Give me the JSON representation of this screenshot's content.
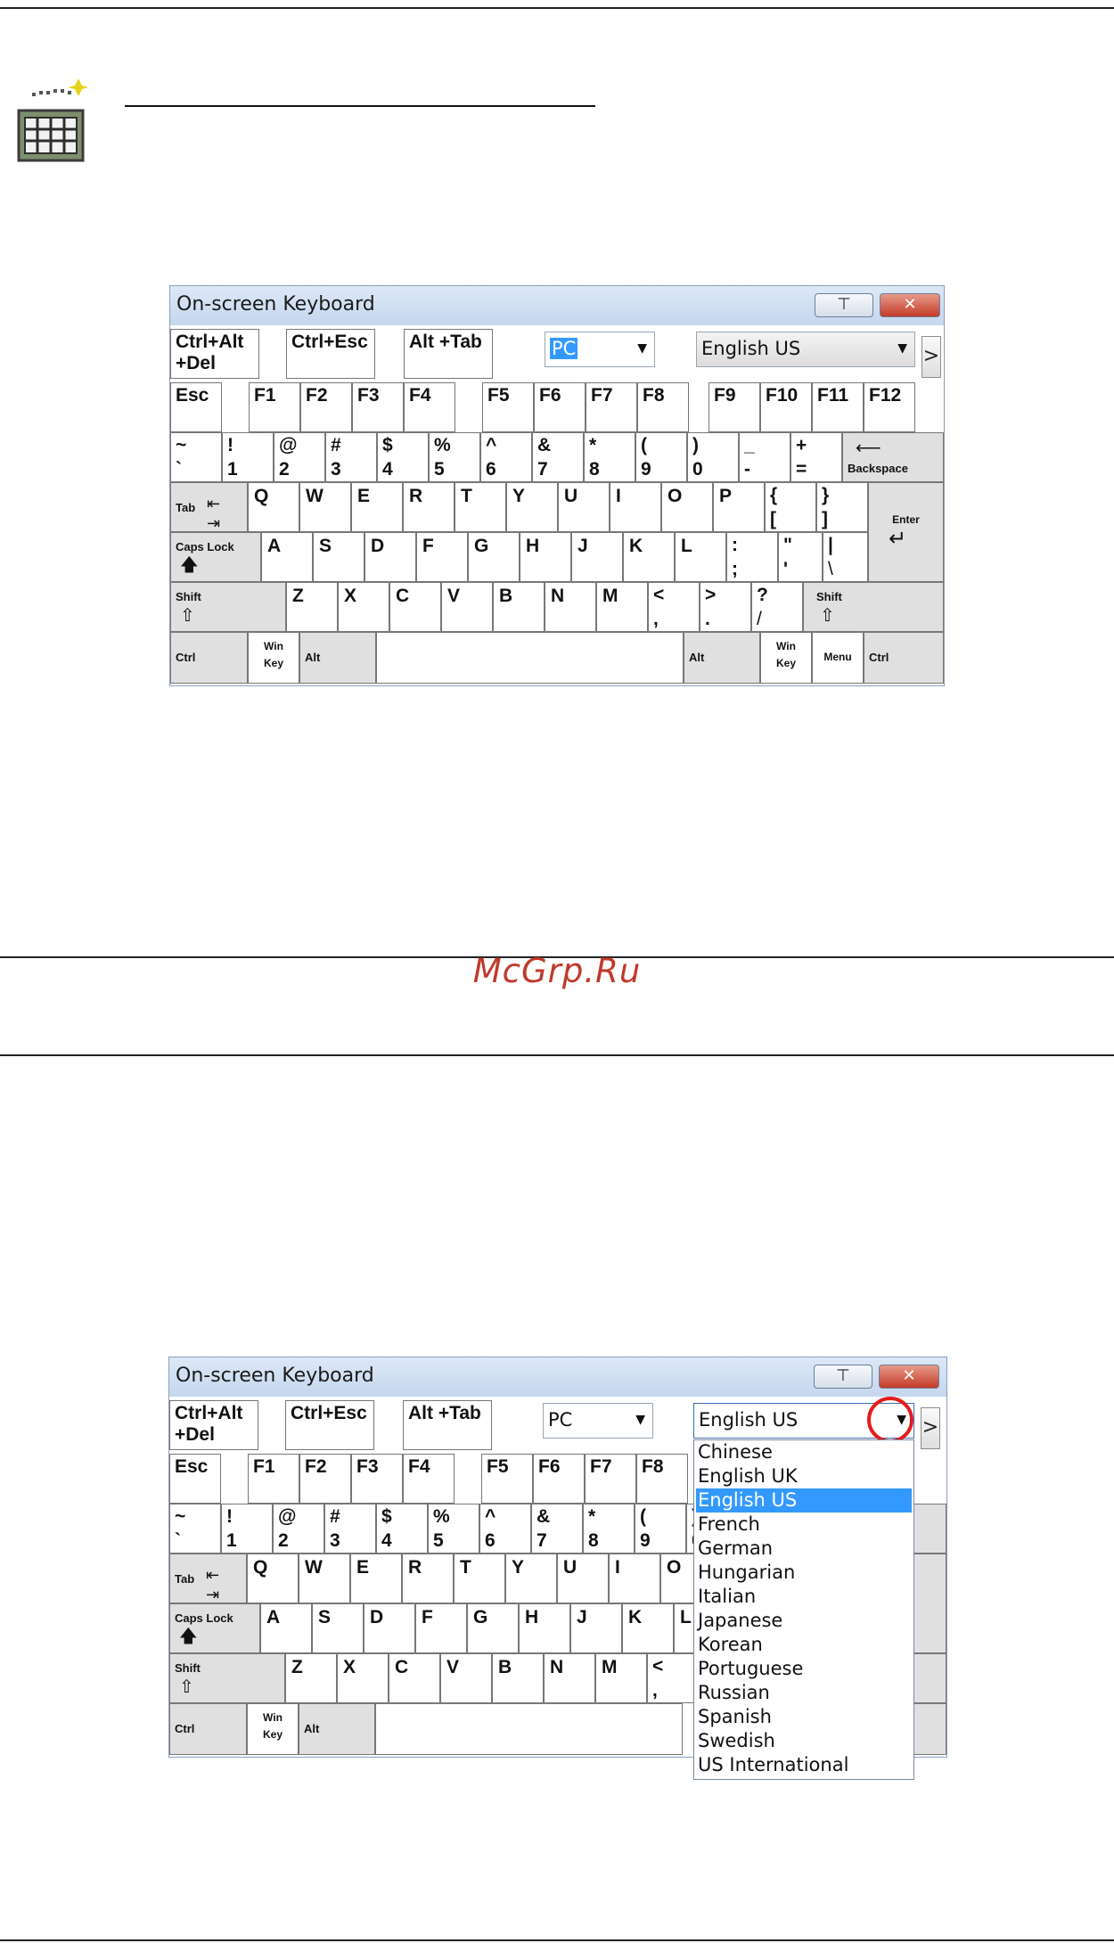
{
  "page": {
    "watermark": "McGrp.Ru"
  },
  "keyboard": {
    "title": "On-screen Keyboard",
    "minimize_label": "⊤",
    "close_label": "✕",
    "type_select_value": "PC",
    "language_select_value": "English US",
    "scroll_label": ">",
    "keys": {
      "ctrl_alt_del_line1": "Ctrl+Alt",
      "ctrl_alt_del_line2": "+Del",
      "ctrl_esc": "Ctrl+Esc",
      "alt_tab": "Alt +Tab",
      "esc": "Esc",
      "f": [
        "F1",
        "F2",
        "F3",
        "F4",
        "F5",
        "F6",
        "F7",
        "F8",
        "F9",
        "F10",
        "F11",
        "F12"
      ],
      "number_row": [
        {
          "top": "~",
          "bottom": "`"
        },
        {
          "top": "!",
          "bottom": "1"
        },
        {
          "top": "@",
          "bottom": "2"
        },
        {
          "top": "#",
          "bottom": "3"
        },
        {
          "top": "$",
          "bottom": "4"
        },
        {
          "top": "%",
          "bottom": "5"
        },
        {
          "top": "^",
          "bottom": "6"
        },
        {
          "top": "&",
          "bottom": "7"
        },
        {
          "top": "*",
          "bottom": "8"
        },
        {
          "top": "(",
          "bottom": "9"
        },
        {
          "top": ")",
          "bottom": "0"
        },
        {
          "top": "_",
          "bottom": "-"
        },
        {
          "top": "+",
          "bottom": "="
        }
      ],
      "backspace": "Backspace",
      "tab": "Tab",
      "q_row": [
        "Q",
        "W",
        "E",
        "R",
        "T",
        "Y",
        "U",
        "I",
        "O",
        "P"
      ],
      "bracket_open": {
        "top": "{",
        "bottom": "["
      },
      "bracket_close": {
        "top": "}",
        "bottom": "]"
      },
      "enter": "Enter",
      "caps_lock": "Caps Lock",
      "a_row": [
        "A",
        "S",
        "D",
        "F",
        "G",
        "H",
        "J",
        "K",
        "L"
      ],
      "semicolon": {
        "top": ":",
        "bottom": ";"
      },
      "quote": {
        "top": "\"",
        "bottom": "'"
      },
      "pipe": {
        "top": "|",
        "bottom": "\\"
      },
      "shift": "Shift",
      "z_row": [
        "Z",
        "X",
        "C",
        "V",
        "B",
        "N",
        "M"
      ],
      "comma": {
        "top": "<",
        "bottom": ","
      },
      "period": {
        "top": ">",
        "bottom": "."
      },
      "slash": {
        "top": "?",
        "bottom": "/"
      },
      "ctrl": "Ctrl",
      "win_key_line1": "Win",
      "win_key_line2": "Key",
      "alt": "Alt",
      "menu": "Menu"
    }
  },
  "language_list": {
    "items": [
      "Chinese",
      "English UK",
      "English US",
      "French",
      "German",
      "Hungarian",
      "Italian",
      "Japanese",
      "Korean",
      "Portuguese",
      "Russian",
      "Spanish",
      "Swedish",
      "US International"
    ],
    "selected": "English US"
  },
  "colors": {
    "title_bar": "#c5d7ee",
    "close_button": "#c43b28",
    "selection": "#3399ff",
    "highlight_circle": "#e51b1b",
    "watermark": "#c0392b"
  }
}
